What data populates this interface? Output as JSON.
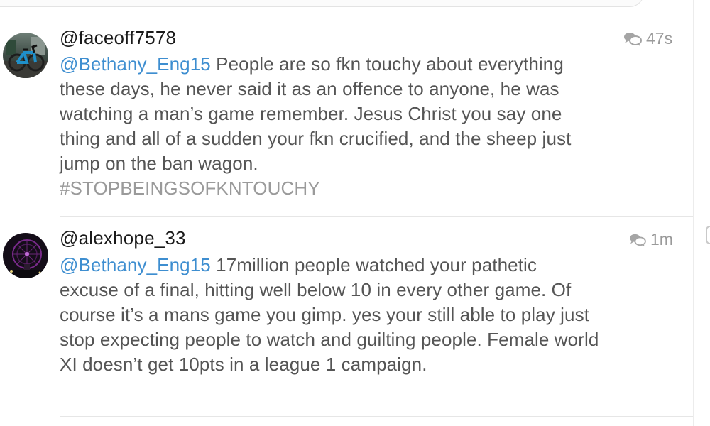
{
  "tweets": [
    {
      "username": "@faceoff7578",
      "time": "47s",
      "mention": "@Bethany_Eng15",
      "text": " People are so fkn touchy about everything these days, he never said it as an offence to anyone, he was watching a man’s game remember.  Jesus Christ you say one thing and all of a sudden your fkn crucified, and the sheep just jump on the ban wagon.",
      "hashtag": "#STOPBEINGSOFKNTOUCHY",
      "avatar_icon": "bicycle-avatar",
      "reply_icon": "reply-icon"
    },
    {
      "username": "@alexhope_33",
      "time": "1m",
      "mention": "@Bethany_Eng15",
      "text": " 17million people watched your pathetic excuse of a final, hitting well below 10 in every other game. Of course it’s a mans game you gimp. yes your still able to play just stop expecting people to watch and guilting people. Female world XI doesn’t get 10pts in a league 1 campaign.",
      "avatar_icon": "night-wheel-avatar",
      "reply_icon": "reply-icon"
    }
  ],
  "colors": {
    "mention": "#3e8ed0",
    "body": "#555555",
    "meta": "#9a9a9a",
    "divider": "#e6e6e6"
  }
}
